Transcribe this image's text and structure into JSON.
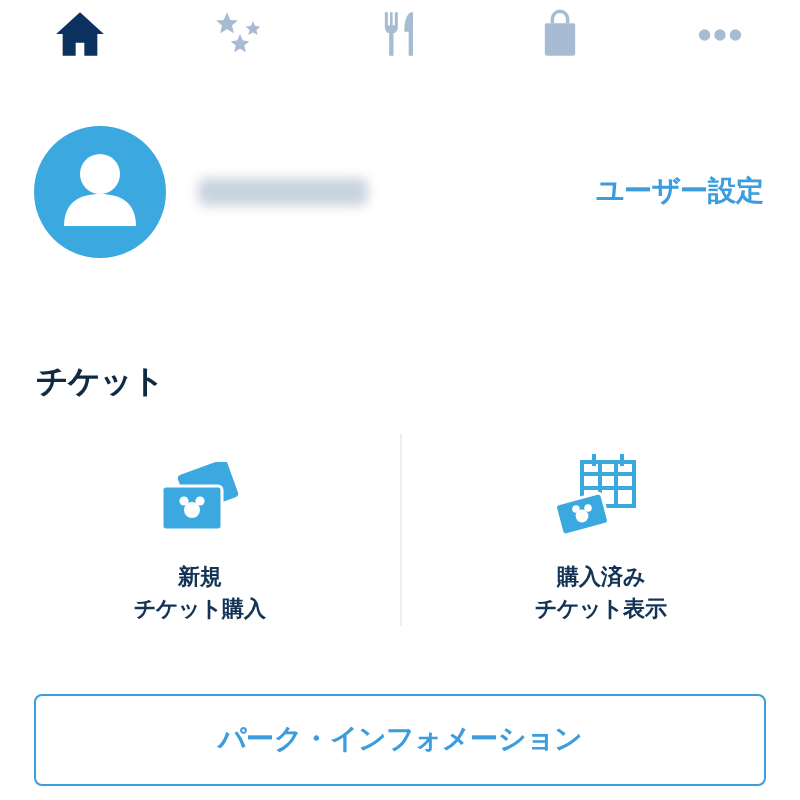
{
  "tabs": [
    {
      "kind": "home",
      "selected": true
    },
    {
      "kind": "stars",
      "selected": false
    },
    {
      "kind": "dining",
      "selected": false
    },
    {
      "kind": "shopping",
      "selected": false
    },
    {
      "kind": "more",
      "selected": false
    }
  ],
  "profile": {
    "settings_link": "ユーザー設定"
  },
  "tickets": {
    "heading": "チケット",
    "items": [
      {
        "kind": "buy",
        "lines": [
          "新規",
          "チケット購入"
        ]
      },
      {
        "kind": "show",
        "lines": [
          "購入済み",
          "チケット表示"
        ]
      }
    ]
  },
  "info_button": "パーク・インフォメーション"
}
